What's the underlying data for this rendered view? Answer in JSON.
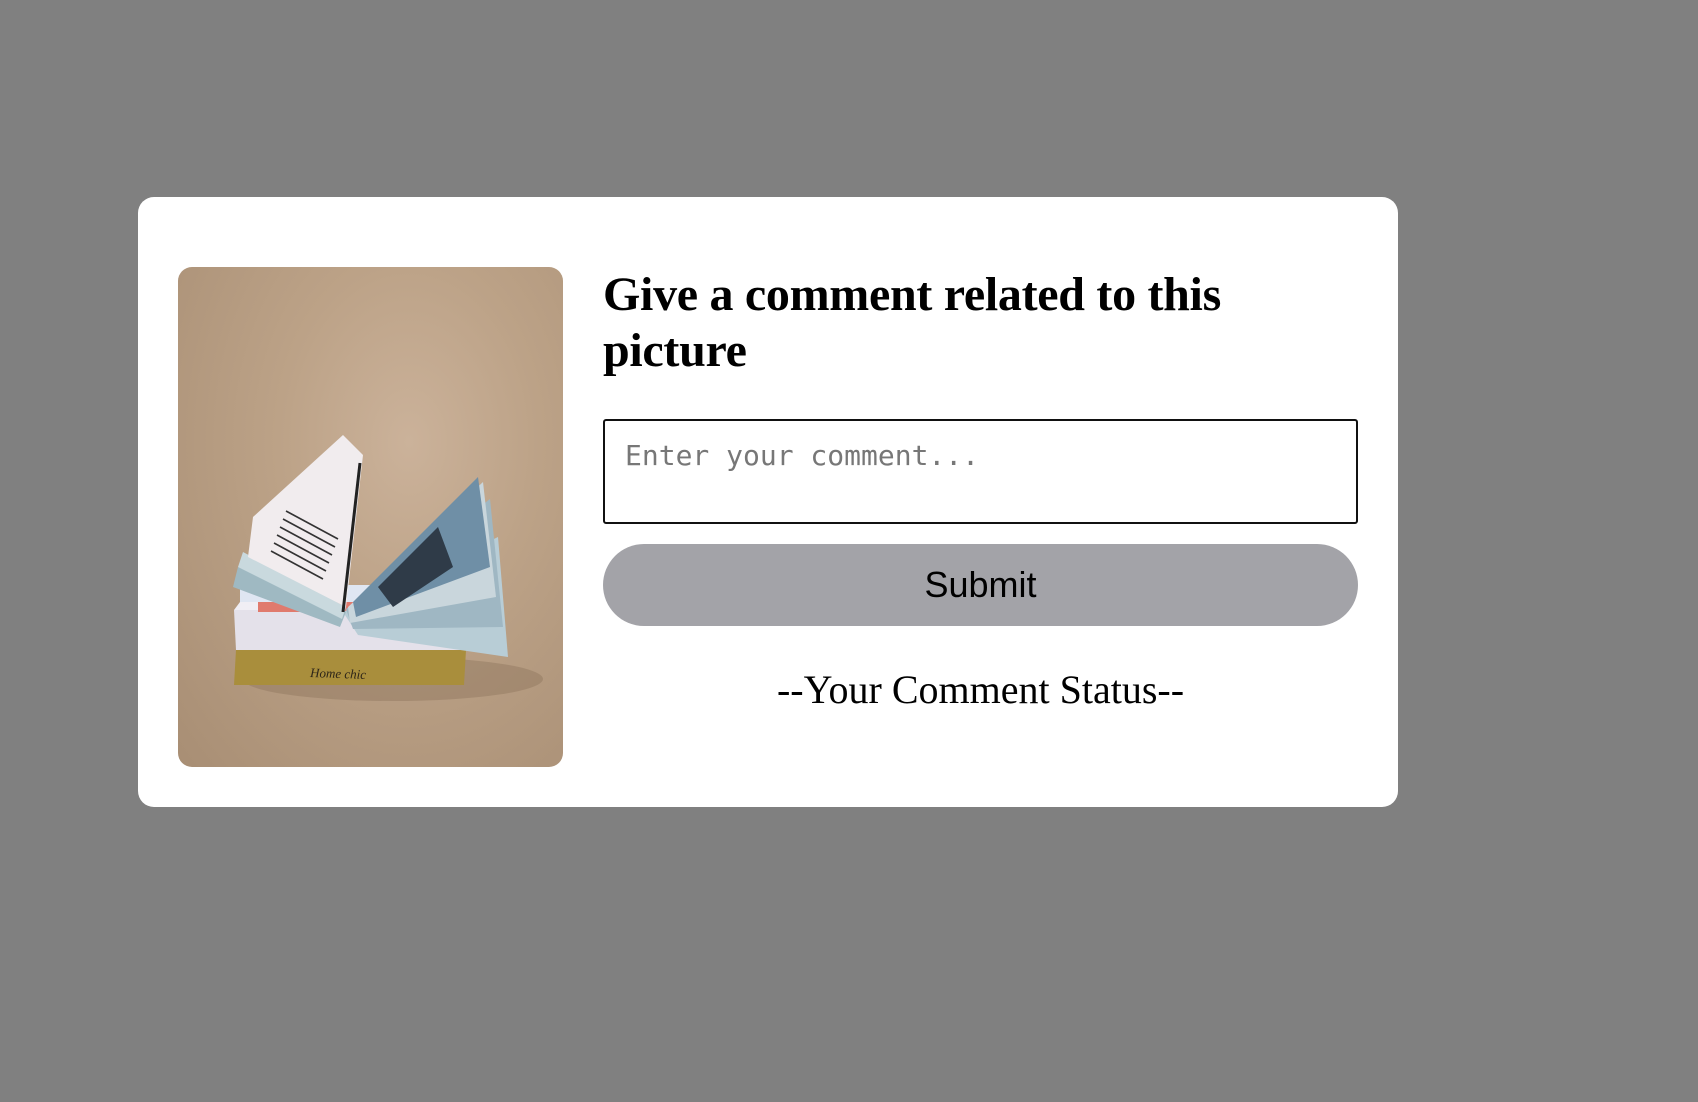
{
  "card": {
    "title": "Give a comment related to this picture",
    "image_alt": "stack-of-books-photo"
  },
  "comment_input": {
    "value": "",
    "placeholder": "Enter your comment..."
  },
  "submit_label": "Submit",
  "status_text": "--Your Comment Status--",
  "book_spines": {
    "lower_spine_text": "Home chic"
  },
  "colors": {
    "page_background": "#808080",
    "card_background": "#ffffff",
    "button_background": "#a3a3a8",
    "photo_background": "#bca287"
  }
}
